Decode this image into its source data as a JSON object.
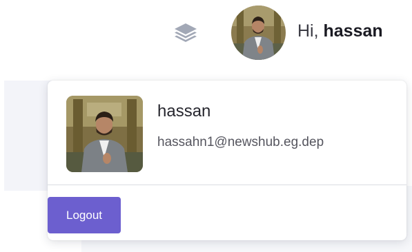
{
  "header": {
    "layers_icon": "layers-icon",
    "greeting_prefix": "Hi, ",
    "greeting_name": "hassan"
  },
  "dropdown": {
    "user_name": "hassan",
    "user_email": "hassahn1@newshub.eg.dep",
    "logout_label": "Logout"
  },
  "colors": {
    "accent": "#6c5fcf",
    "page_bg_panel": "#f3f4f9"
  }
}
